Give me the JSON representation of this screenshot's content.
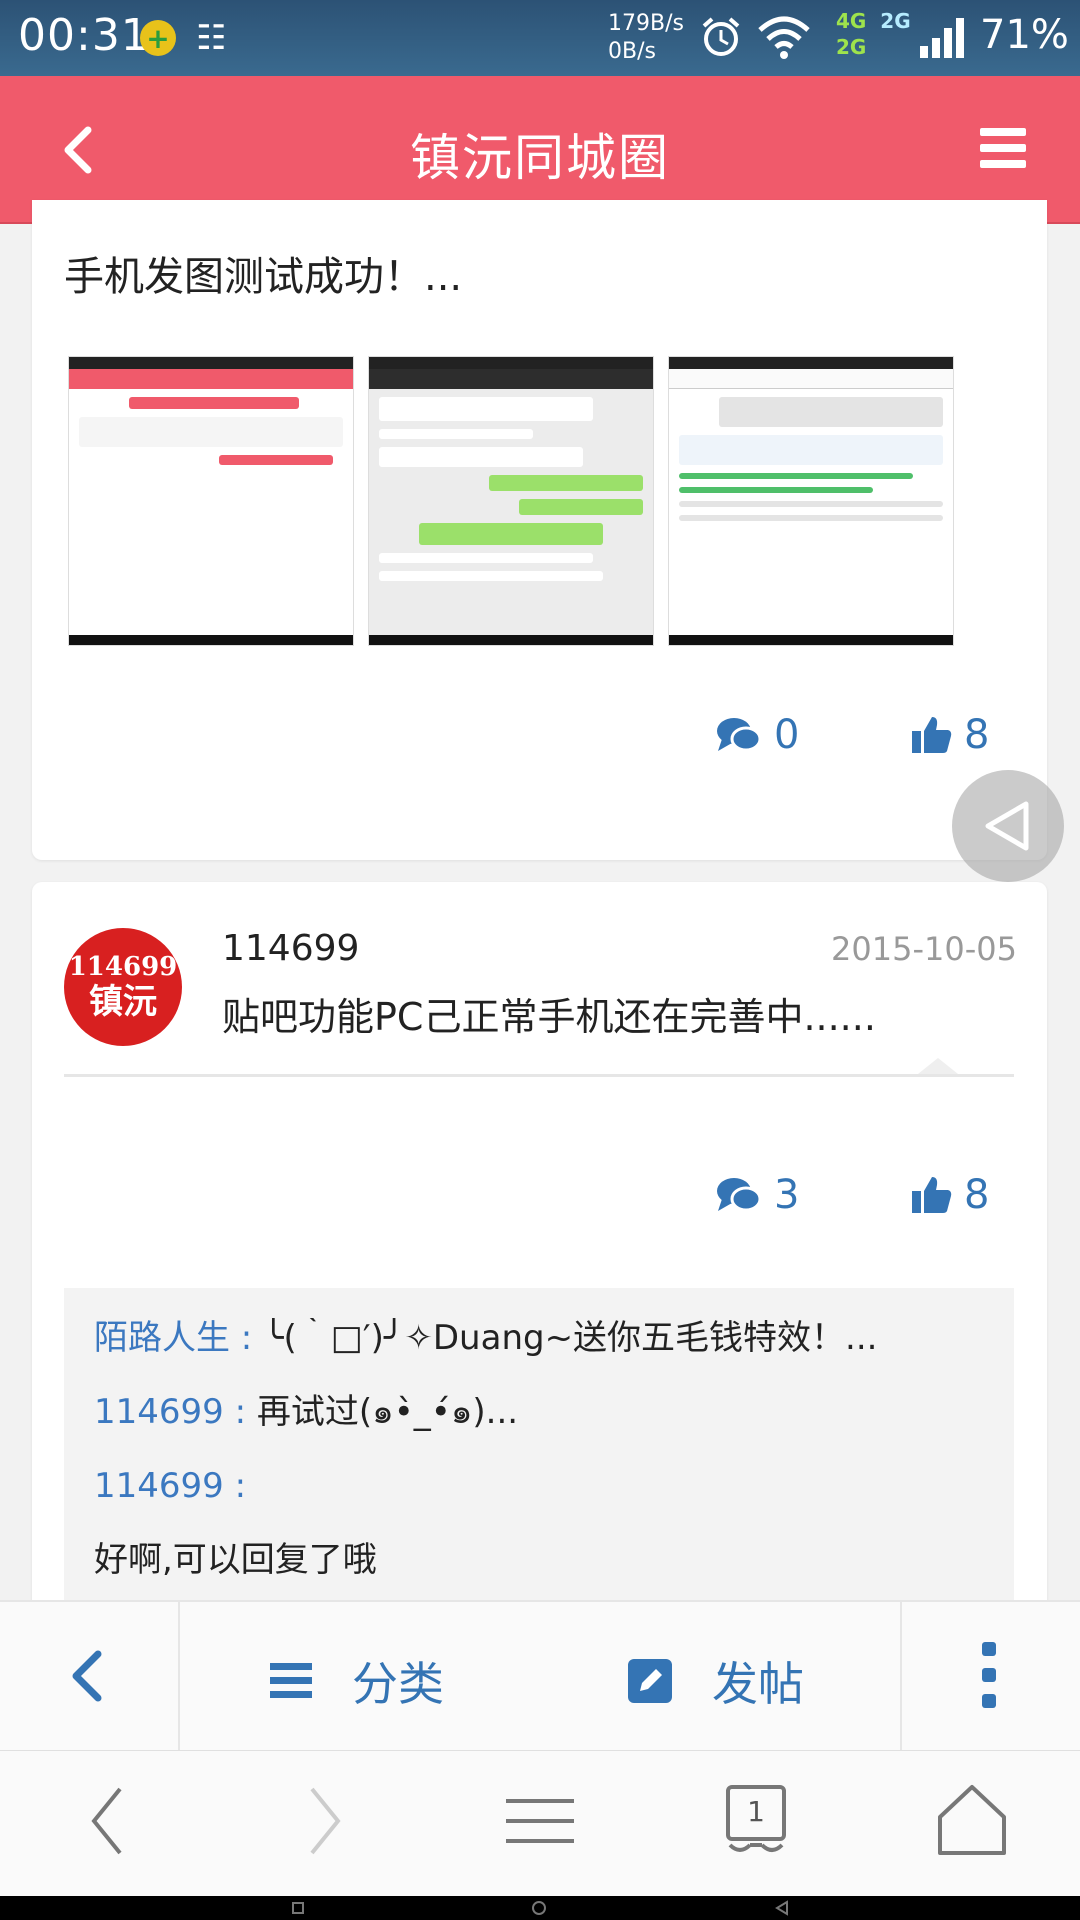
{
  "status_bar": {
    "time": "00:31",
    "speed_up": "179B/s",
    "speed_down": "0B/s",
    "net_4g": "4G",
    "net_2g_top": "2G",
    "net_2g": "2G",
    "battery": "71%"
  },
  "header": {
    "title": "镇沅同城圈"
  },
  "post1": {
    "text": "手机发图测试成功！...",
    "comments": "0",
    "likes": "8",
    "thumbnails": [
      "screenshot-1",
      "screenshot-2",
      "screenshot-3"
    ]
  },
  "post2": {
    "avatar_line1": "114699",
    "avatar_line2": "镇沅",
    "username": "114699",
    "date": "2015-10-05",
    "text": "贴吧功能PC己正常手机还在完善中......",
    "comments": "3",
    "likes": "8",
    "replies": [
      {
        "who": "陌路人生 : ",
        "text": "╰(｀□′)╯✧Duang~送你五毛钱特效！..."
      },
      {
        "who": "114699 : ",
        "text": "再试过(๑•̀_•́๑)..."
      },
      {
        "who": "114699 : ",
        "text": ""
      },
      {
        "who": "",
        "text": "好啊,可以回复了哦"
      }
    ]
  },
  "toolbar": {
    "category_label": "分类",
    "post_label": "发帖"
  },
  "browser": {
    "tab_count": "1"
  },
  "colors": {
    "accent": "#f05a6b",
    "link": "#3474b4"
  }
}
